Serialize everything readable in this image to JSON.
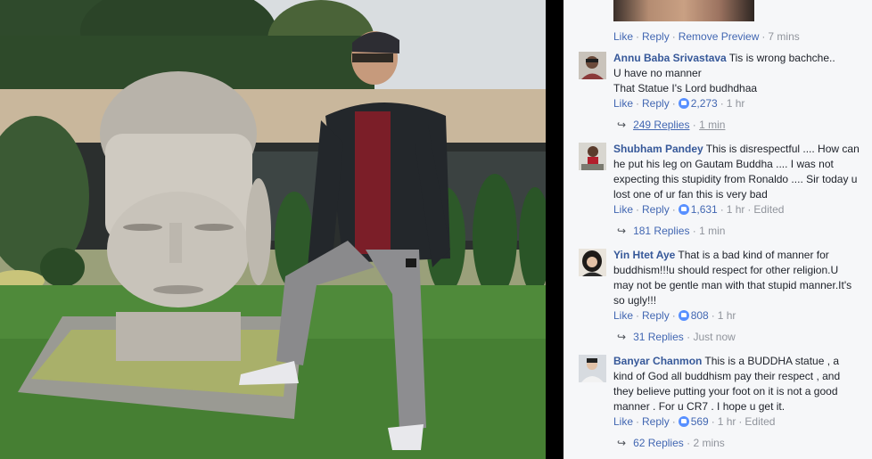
{
  "preview_row": {
    "like": "Like",
    "reply": "Reply",
    "remove_preview": "Remove Preview",
    "time": "7 mins"
  },
  "comments": [
    {
      "author": "Annu Baba Srivastava",
      "lines": [
        "Tis is wrong bachche..",
        "U have no manner",
        "That Statue I's Lord budhdhaa"
      ],
      "like": "Like",
      "reply": "Reply",
      "likes": "2,273",
      "time": "1 hr",
      "edited": "",
      "replies_label": "249 Replies",
      "replies_time": "1 min"
    },
    {
      "author": "Shubham Pandey",
      "lines": [
        "This is disrespectful .... How can",
        "he put his leg on Gautam Buddha .... I was not",
        "expecting this stupidity from Ronaldo .... Sir today u",
        "lost one of ur fan this is very bad"
      ],
      "like": "Like",
      "reply": "Reply",
      "likes": "1,631",
      "time": "1 hr",
      "edited": "Edited",
      "replies_label": "181 Replies",
      "replies_time": "1 min"
    },
    {
      "author": "Yin Htet Aye",
      "lines": [
        "That is a bad kind of manner for",
        "buddhism!!!u should respect for other religion.U",
        "may not be gentle man with that stupid manner.It's",
        "so ugly!!!"
      ],
      "like": "Like",
      "reply": "Reply",
      "likes": "808",
      "time": "1 hr",
      "edited": "",
      "replies_label": "31 Replies",
      "replies_time": "Just now"
    },
    {
      "author": "Banyar Chanmon",
      "lines": [
        "This is a BUDDHA statue ,  a",
        "kind of God all buddhism pay their respect , and",
        "they believe putting your foot on it is not a good",
        "manner . For u CR7 . I hope u get it."
      ],
      "like": "Like",
      "reply": "Reply",
      "likes": "569",
      "time": "1 hr",
      "edited": "Edited",
      "replies_label": "62 Replies",
      "replies_time": "2 mins"
    }
  ],
  "icons": {
    "like_reaction": "like-reaction-icon",
    "reply_arrow": "reply-arrow-icon"
  },
  "colors": {
    "link": "#4267b2",
    "author": "#365899",
    "meta": "#90949c",
    "panel_bg": "#f6f7f9",
    "like_badge": "#5890ff"
  }
}
